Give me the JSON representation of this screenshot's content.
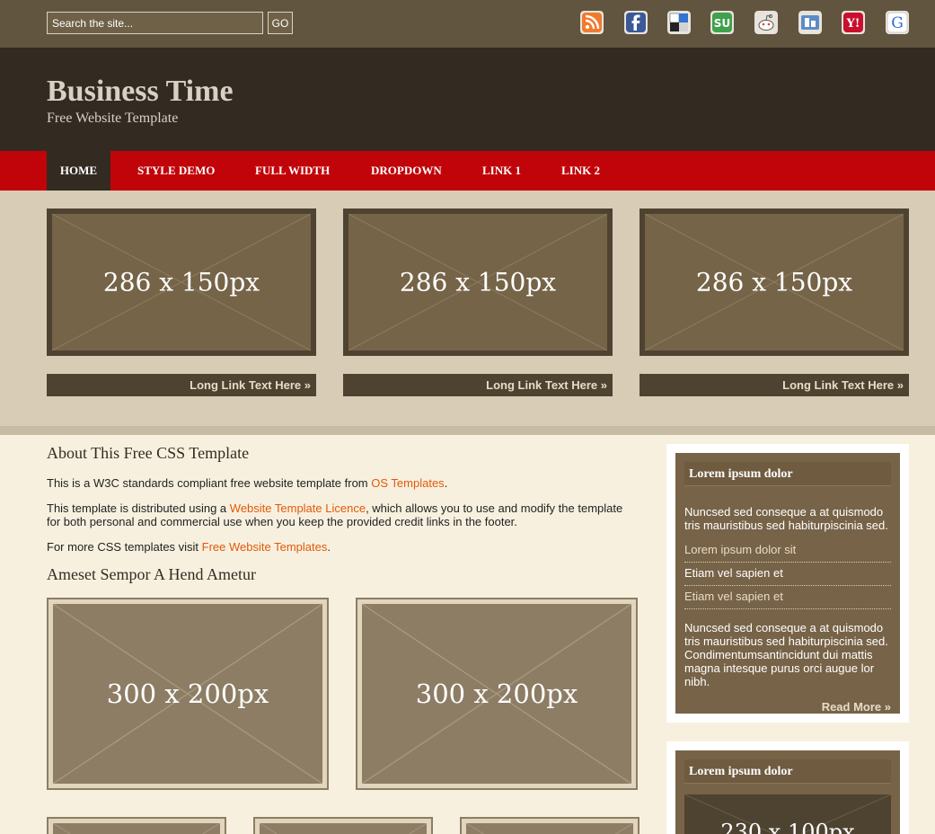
{
  "search": {
    "placeholder": "Search the site...",
    "go_label": "GO"
  },
  "social_icons": [
    "rss-icon",
    "facebook-icon",
    "delicious-icon",
    "stumbleupon-icon",
    "reddit-icon",
    "digg-icon",
    "yahoo-icon",
    "google-icon"
  ],
  "header": {
    "title": "Business Time",
    "tagline": "Free Website Template"
  },
  "nav": {
    "items": [
      {
        "label": "Home",
        "active": true
      },
      {
        "label": "Style Demo"
      },
      {
        "label": "Full Width"
      },
      {
        "label": "DropDown"
      },
      {
        "label": "Link 1"
      },
      {
        "label": "Link 2"
      }
    ]
  },
  "featured": [
    {
      "image_label": "286 x 150px",
      "link": "Long Link Text Here »"
    },
    {
      "image_label": "286 x 150px",
      "link": "Long Link Text Here »"
    },
    {
      "image_label": "286 x 150px",
      "link": "Long Link Text Here »"
    }
  ],
  "content": {
    "heading1": "About This Free CSS Template",
    "p1": {
      "pre": "This is a W3C standards compliant free website template from ",
      "link": "OS Templates",
      "post": "."
    },
    "p2": {
      "pre": "This template is distributed using a ",
      "link": "Website Template Licence",
      "post": ", which allows you to use and modify the template for both personal and commercial use when you keep the provided credit links in the footer."
    },
    "p3": {
      "pre": "For more CSS templates visit ",
      "link": "Free Website Templates",
      "post": "."
    },
    "heading2": "Ameset Sempor A Hend Ametur",
    "gallery_large": [
      "300 x 200px",
      "300 x 200px"
    ]
  },
  "sidebar": {
    "box1": {
      "heading": "Lorem ipsum dolor",
      "intro": "Nuncsed sed conseque a at quismodo tris mauristibus sed habiturpiscinia sed.",
      "links": [
        "Lorem ipsum dolor sit",
        "Etiam vel sapien et",
        "Etiam vel sapien et"
      ],
      "body": "Nuncsed sed conseque a at quismodo tris mauristibus sed habiturpiscinia sed. Condimentumsantincidunt dui mattis magna intesque purus orci augue lor nibh.",
      "more": "Read More »"
    },
    "box2": {
      "heading": "Lorem ipsum dolor",
      "image_label": "230 x 100px"
    }
  },
  "colors": {
    "topbar": "#61553F",
    "header": "#332B22",
    "nav": "#C1040A",
    "nav_active": "#332B22",
    "featured_bg": "#D8CCB6",
    "content_bg": "#F8F0DF",
    "link": "#E05A0A",
    "sidebar_box": "#776347"
  }
}
